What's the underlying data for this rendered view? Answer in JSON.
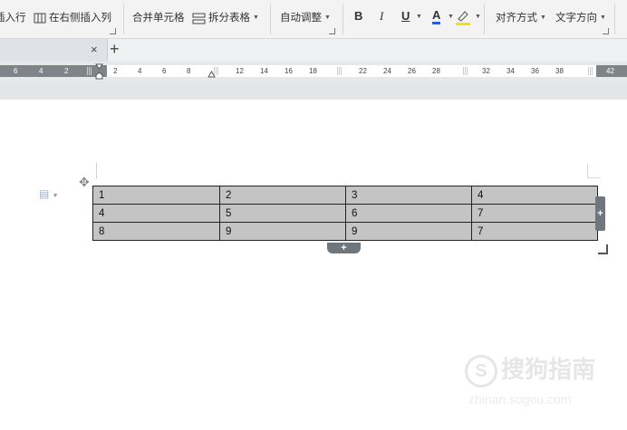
{
  "ribbon": {
    "insert_row": "插入行",
    "insert_right_col": "在右侧插入列",
    "merge_cells": "合并单元格",
    "split_table": "拆分表格",
    "auto_adjust": "自动调整",
    "bold": "B",
    "italic": "I",
    "underline": "U",
    "font_color": "A",
    "align": "对齐方式",
    "text_direction": "文字方向"
  },
  "tabs": {
    "close": "×",
    "new": "+"
  },
  "ruler": {
    "left_numbers": [
      "6",
      "4",
      "2"
    ],
    "numbers": [
      "2",
      "4",
      "6",
      "8",
      "12",
      "14",
      "16",
      "18",
      "22",
      "24",
      "26",
      "28",
      "32",
      "34",
      "36",
      "38",
      "42"
    ]
  },
  "table": {
    "rows": [
      [
        "1",
        "2",
        "3",
        "4"
      ],
      [
        "4",
        "5",
        "6",
        "7"
      ],
      [
        "8",
        "9",
        "9",
        "7"
      ]
    ]
  },
  "controls": {
    "add_column": "+",
    "add_row": "+"
  },
  "watermark": {
    "brand": "搜狗指南",
    "url": "zhinan.sogou.com"
  }
}
